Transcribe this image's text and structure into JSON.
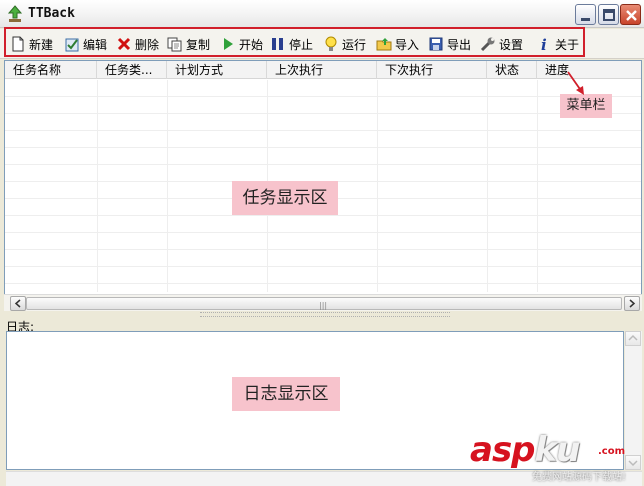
{
  "window": {
    "title": "TTBack",
    "controls": [
      "minimize",
      "maximize",
      "close"
    ]
  },
  "toolbar": {
    "items": [
      {
        "label": "新建",
        "icon": "new-file-icon"
      },
      {
        "label": "编辑",
        "icon": "edit-icon"
      },
      {
        "label": "删除",
        "icon": "delete-icon"
      },
      {
        "label": "复制",
        "icon": "copy-icon"
      },
      {
        "label": "开始",
        "icon": "play-icon"
      },
      {
        "label": "停止",
        "icon": "pause-icon"
      },
      {
        "label": "运行",
        "icon": "lightbulb-icon"
      },
      {
        "label": "导入",
        "icon": "import-folder-icon"
      },
      {
        "label": "导出",
        "icon": "save-icon"
      },
      {
        "label": "设置",
        "icon": "wrench-icon"
      },
      {
        "label": "关于",
        "icon": "info-icon"
      }
    ]
  },
  "task_table": {
    "columns": [
      "任务名称",
      "任务类...",
      "计划方式",
      "上次执行",
      "下次执行",
      "状态",
      "进度"
    ],
    "rows": []
  },
  "log": {
    "label": "日志:",
    "content": ""
  },
  "annotations": {
    "menu_bar": "菜单栏",
    "task_area": "任务显示区",
    "log_area": "日志显示区"
  },
  "watermark": {
    "brand_asp": "asp",
    "brand_ku": "ku",
    "domain_suffix": ".com",
    "tagline": "免费网站源码下载站!"
  },
  "colors": {
    "annotation_bg": "#f7c3cc",
    "highlight_border": "#d11f2b",
    "watermark_red": "#d6121f"
  }
}
